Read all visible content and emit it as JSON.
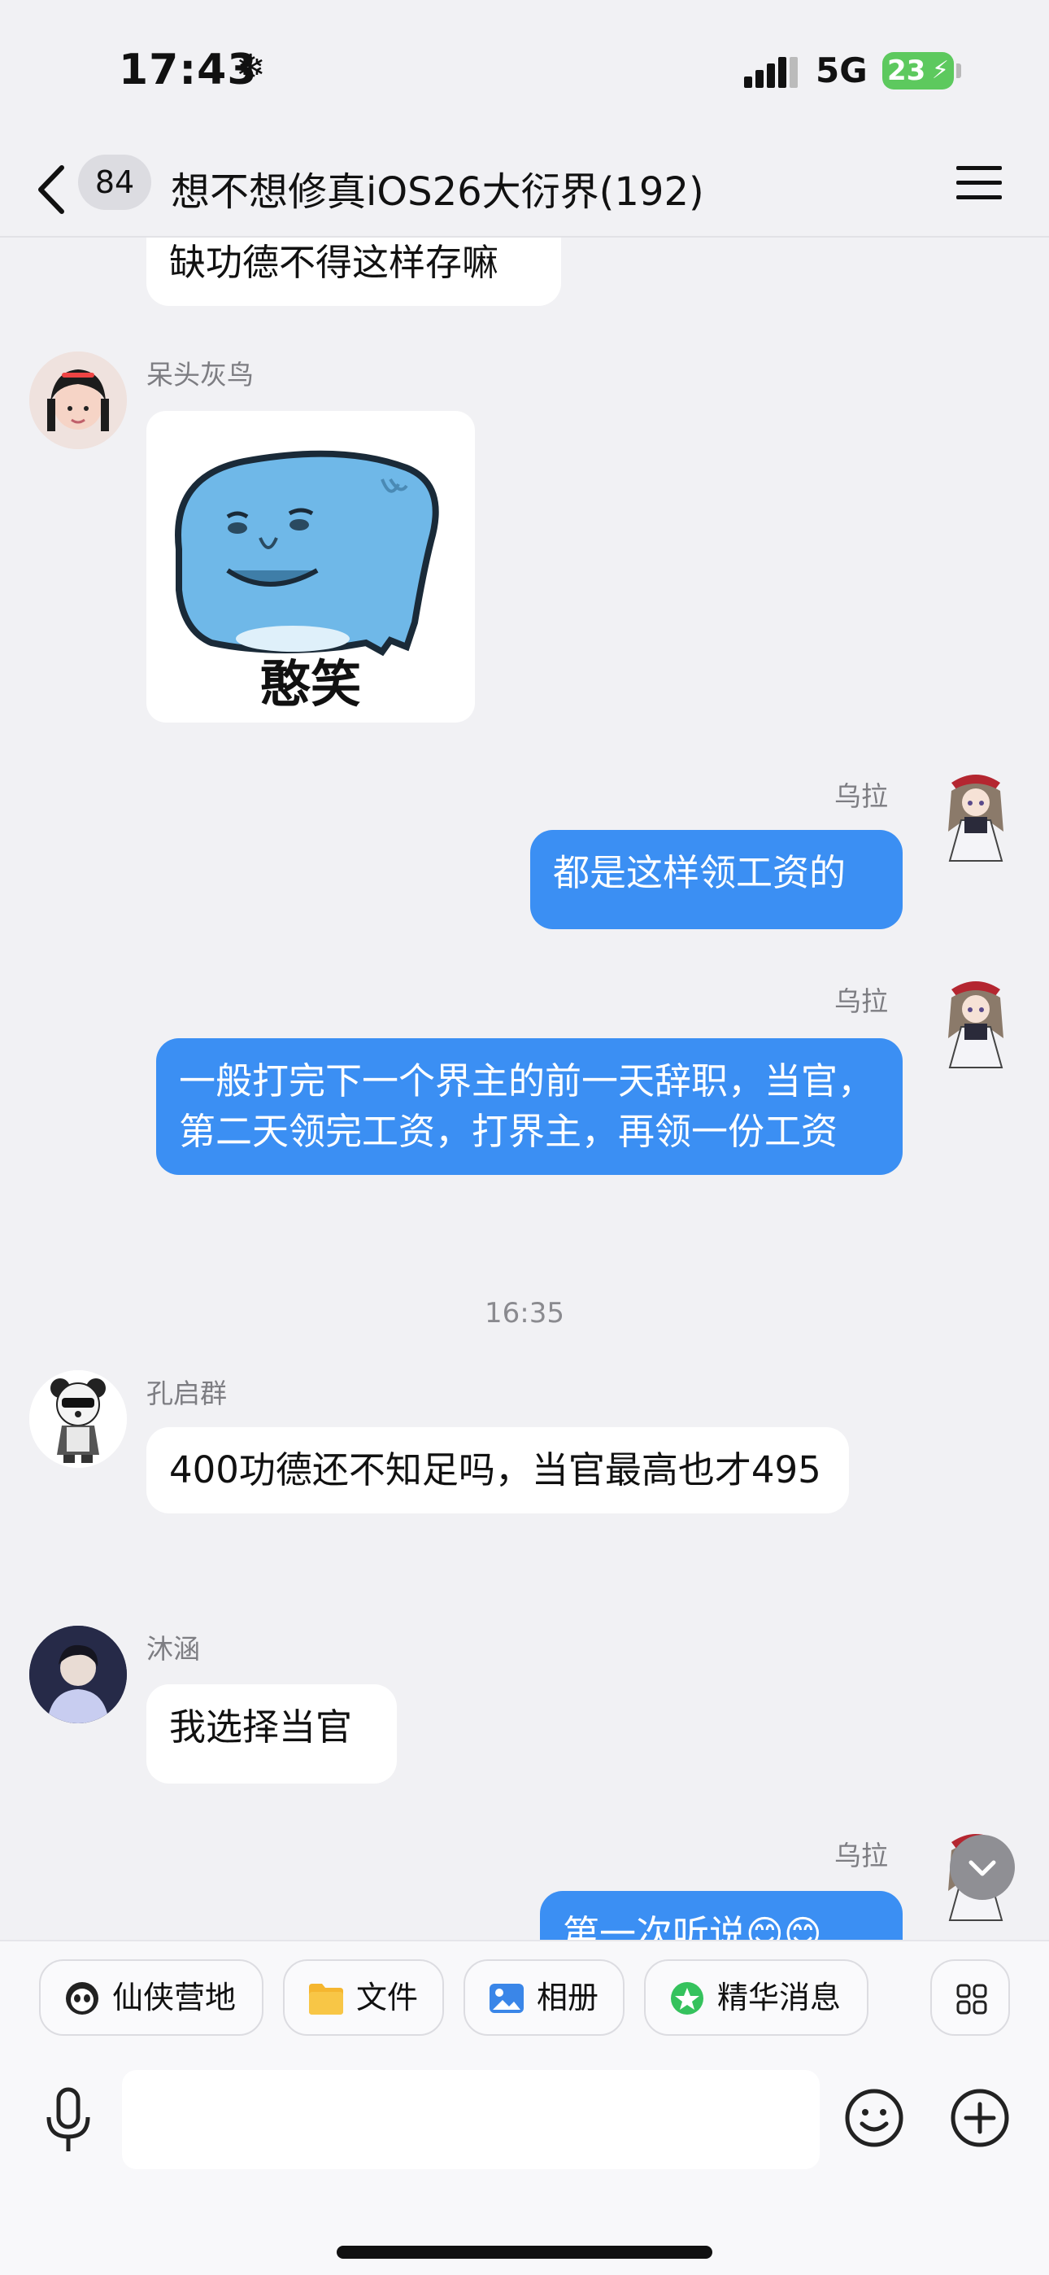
{
  "status_bar": {
    "time": "17:43",
    "weather_glyph": "❄",
    "network": "5G",
    "battery": "23",
    "battery_glyph": "⚡"
  },
  "nav": {
    "unread_count": "84",
    "title": "想不想修真iOS26大衍界(192)"
  },
  "messages": [
    {
      "sender": "",
      "text": "缺功德不得这样存嘛",
      "direction": "in"
    },
    {
      "sender": "呆头灰鸟",
      "sticker_caption": "憨笑",
      "direction": "in"
    },
    {
      "sender": "乌拉",
      "text": "都是这样领工资的",
      "direction": "out"
    },
    {
      "sender": "乌拉",
      "text": "一般打完下一个界主的前一天辞职，当官，第二天领完工资，打界主，再领一份工资",
      "direction": "out"
    },
    {
      "timestamp": "16:35"
    },
    {
      "sender": "孔启群",
      "text": "400功德还不知足吗，当官最高也才495",
      "direction": "in"
    },
    {
      "sender": "沐涵",
      "text": "我选择当官",
      "direction": "in"
    },
    {
      "sender": "乌拉",
      "text": "第一次听说😊😊",
      "direction": "out"
    }
  ],
  "toolbar": {
    "chips": [
      {
        "label": "仙侠营地",
        "icon": "panda-app-icon"
      },
      {
        "label": "文件",
        "icon": "folder-icon"
      },
      {
        "label": "相册",
        "icon": "photo-icon"
      },
      {
        "label": "精华消息",
        "icon": "star-badge-icon"
      }
    ],
    "input_placeholder": ""
  },
  "colors": {
    "outgoing_bubble": "#3b8ff3",
    "incoming_bubble": "#ffffff",
    "background": "#f1f1f4"
  }
}
